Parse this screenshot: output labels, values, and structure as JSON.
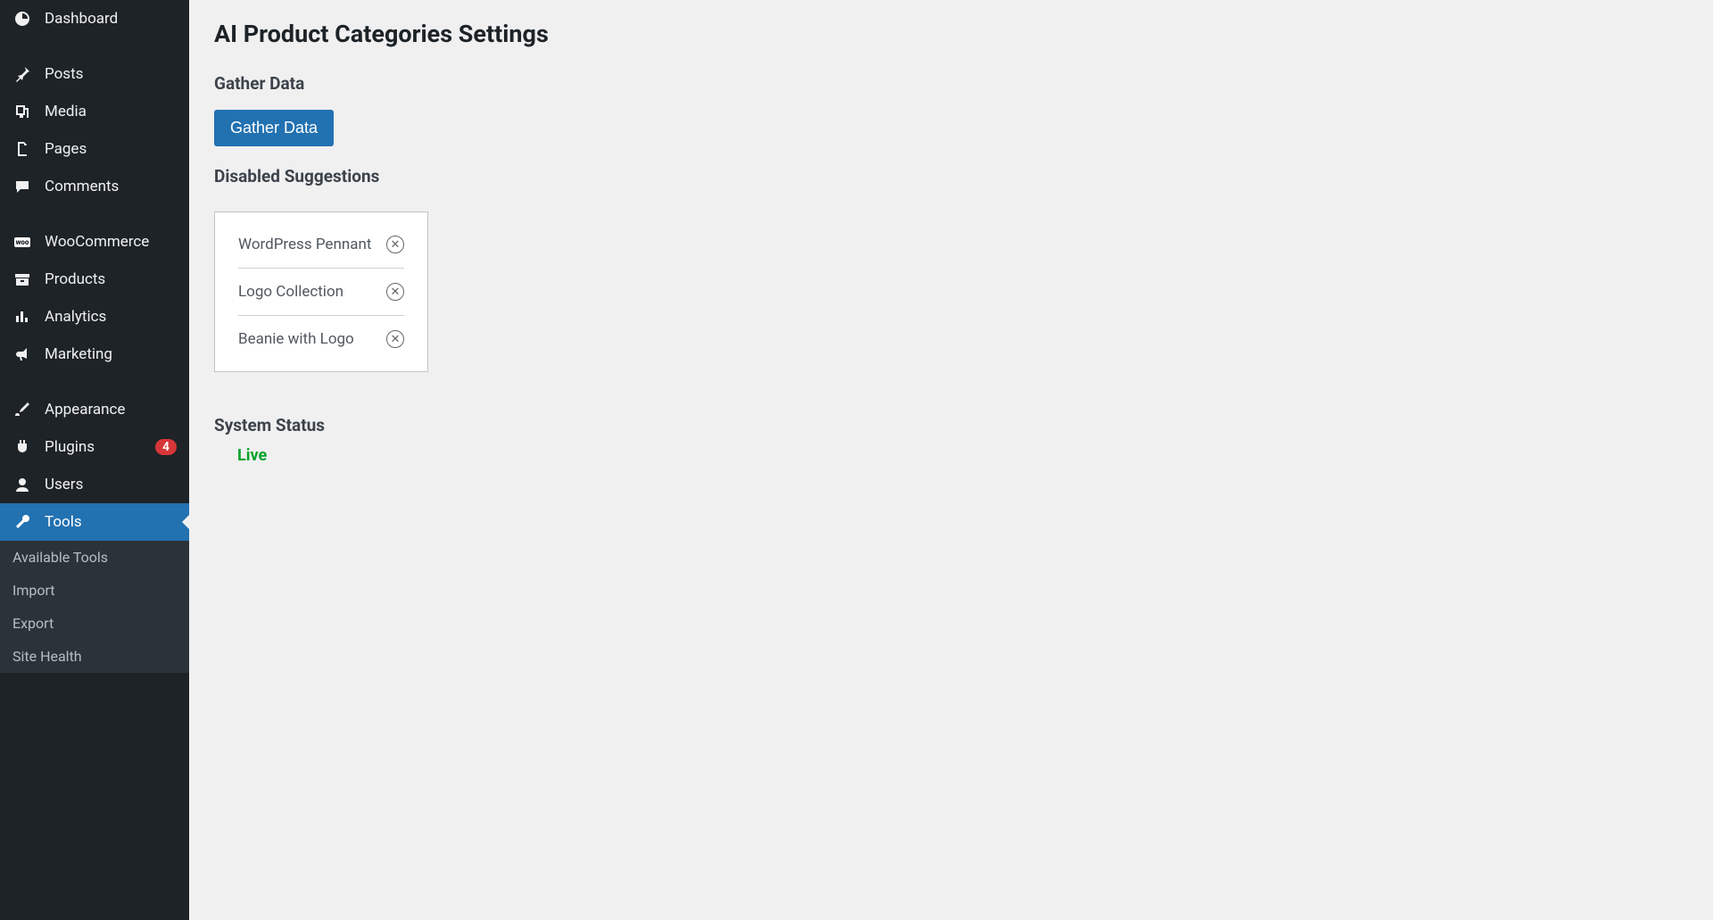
{
  "sidebar": {
    "items": [
      {
        "label": "Dashboard"
      },
      {
        "label": "Posts"
      },
      {
        "label": "Media"
      },
      {
        "label": "Pages"
      },
      {
        "label": "Comments"
      },
      {
        "label": "WooCommerce"
      },
      {
        "label": "Products"
      },
      {
        "label": "Analytics"
      },
      {
        "label": "Marketing"
      },
      {
        "label": "Appearance"
      },
      {
        "label": "Plugins",
        "badge": "4"
      },
      {
        "label": "Users"
      },
      {
        "label": "Tools"
      }
    ],
    "submenu": [
      {
        "label": "Available Tools"
      },
      {
        "label": "Import"
      },
      {
        "label": "Export"
      },
      {
        "label": "Site Health"
      }
    ]
  },
  "main": {
    "title": "AI Product Categories Settings",
    "sections": {
      "gather": {
        "heading": "Gather Data",
        "button": "Gather Data"
      },
      "disabled": {
        "heading": "Disabled Suggestions",
        "items": [
          {
            "name": "WordPress Pennant"
          },
          {
            "name": "Logo Collection"
          },
          {
            "name": "Beanie with Logo"
          }
        ]
      },
      "status": {
        "heading": "System Status",
        "value": "Live"
      }
    }
  }
}
